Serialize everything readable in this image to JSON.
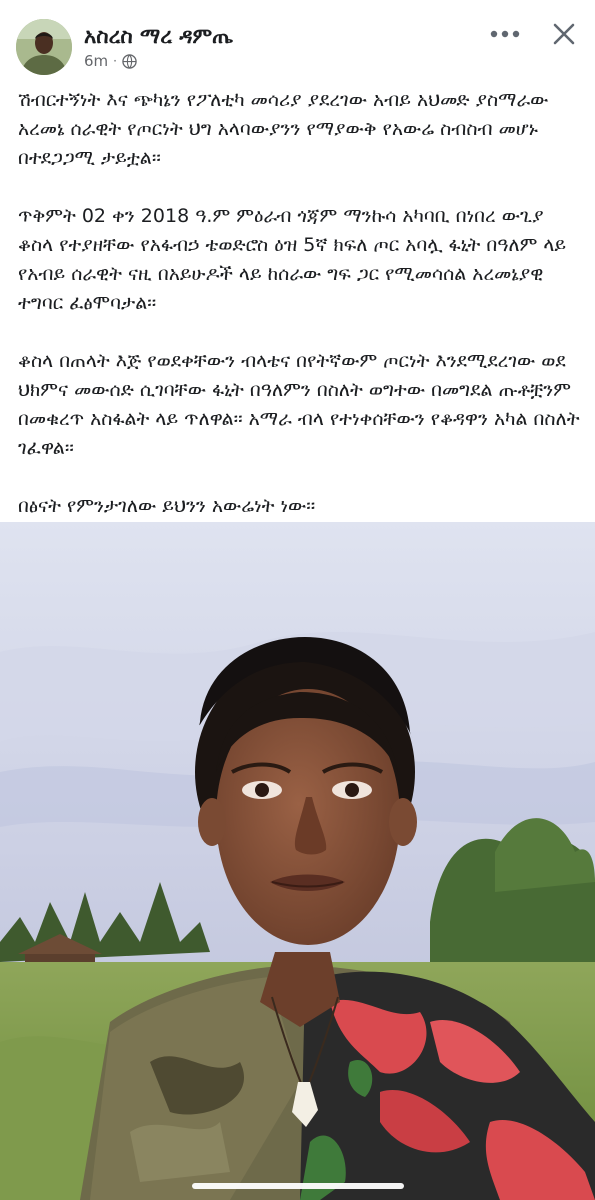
{
  "post": {
    "author_name": "አስረስ ማረ ዳምጤ",
    "time": "6m",
    "separator": "·",
    "paragraphs": [
      "ሽብርተኝነት እና ጭካኔን የፖለቲካ መሳሪያ ያደረገው አብይ አህመድ ያስማራው አረመኔ ሰራዊት የጦርነት ህግ አላባውያንን የማያውቅ የአውሬ ስብስብ መሆኑ በተደጋጋሚ ታይቷል፡፡",
      "ጥቅምት 02 ቀን 2018 ዓ.ም ምዕራብ ጎጃም ማንኩሳ አካባቢ በነበረ ውጊያ ቆስላ የተያዘቸው የአፋብኃ ቴወድሮስ ዕዝ  5ኛ ክፍለ ጦር አባሏ ፋኒት በዓለም ላይ የአብይ ሰራዊት ናዚ በአይሁዶች ላይ ከሰራው ግፍ ጋር የሚመሳሰል አረመኔያዊ ተግባር ፈፅሞባታል፡፡",
      "ቆስላ በጠላት እጅ የወደቀቸውን ብላቴና በየትኛውም ጦርነት እንደሚደረገው ወደ ህክምና መውሰድ ሲገባቸው ፋኒት በዓለምን በስለት ወግተው በመግደል ጡቶቿንም በመቁረጥ አስፋልት ላይ ጥለዋል፡፡ አማራ ብላ የተነቀሰቸውን የቆዳዋን አካል በስለት ገፈዋል፡፡",
      "በፅናት የምንታገለው ይህንን አውሬነት ነው፡፡"
    ]
  },
  "icons": {
    "avatar": "profile-avatar",
    "privacy": "globe-icon",
    "more": "more-dots-icon",
    "close": "close-icon"
  },
  "colors": {
    "text": "#1c1e21",
    "meta": "#65676b",
    "icon": "#606770"
  }
}
